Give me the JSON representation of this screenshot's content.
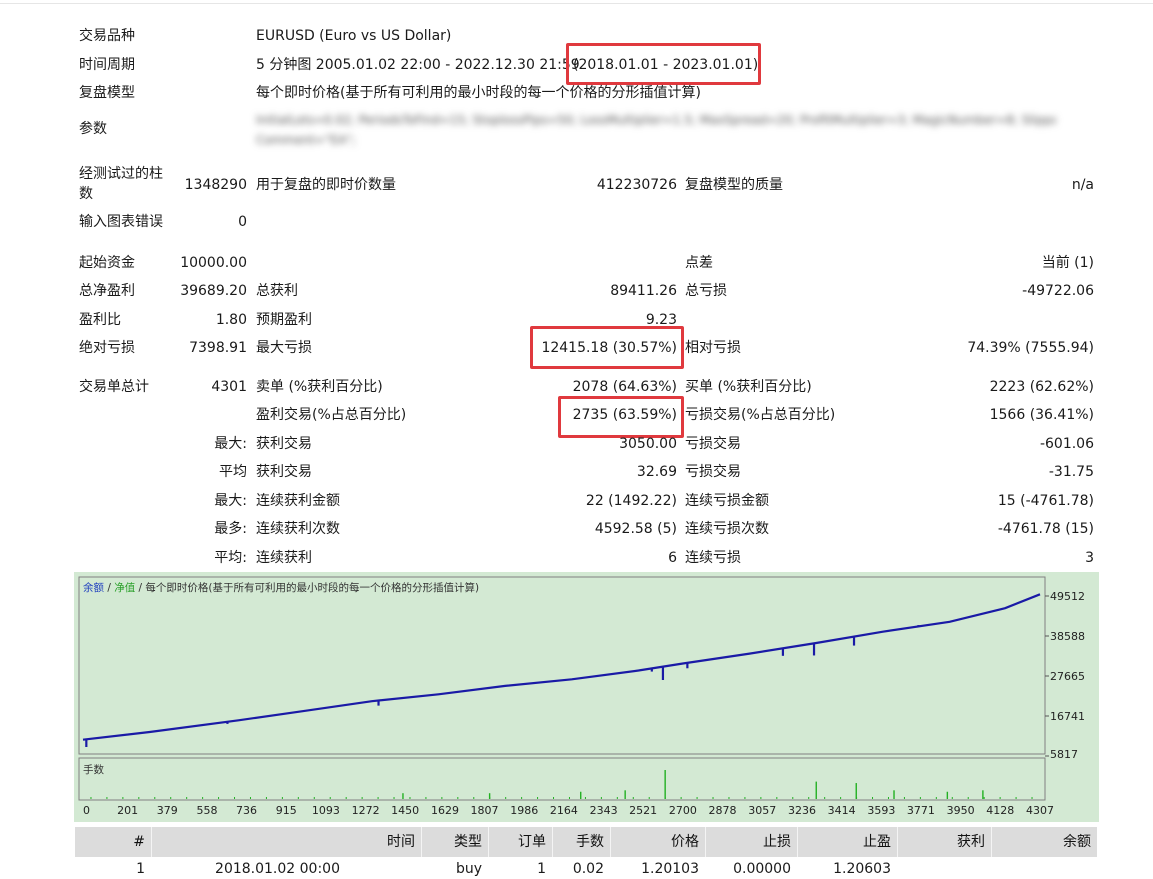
{
  "info": {
    "symbol_label": "交易品种",
    "symbol_value": "EURUSD (Euro vs US Dollar)",
    "period_label": "时间周期",
    "period_value": "5 分钟图 2005.01.02 22:00 - 2022.12.30 21:59",
    "period_range": "(2018.01.01 - 2023.01.01)",
    "model_label": "复盘模型",
    "model_value": "每个即时价格(基于所有可利用的最小时段的每一个价格的分形插值计算)",
    "params_label": "参数",
    "params_line1": "InitialLots=0.02; PeriodsToFind=15; StoplossPips=50; LossMultiplier=1.5; MaxSpread=20; ProfitMultiplier=3; MagicNumber=8; Slippage=7;",
    "params_line2": "Comment=\"EA\";",
    "bars_label_1": "经测试过的柱",
    "bars_label_2": "数",
    "bars_value": "1348290",
    "ticks_label": "用于复盘的即时价数量",
    "ticks_value": "412230726",
    "quality_label": "复盘模型的质量",
    "quality_value": "n/a",
    "errors_label": "输入图表错误",
    "errors_value": "0"
  },
  "stats": {
    "initial_deposit_label": "起始资金",
    "initial_deposit": "10000.00",
    "spread_label": "点差",
    "spread": "当前 (1)",
    "net_profit_label": "总净盈利",
    "net_profit": "39689.20",
    "gross_profit_label": "总获利",
    "gross_profit": "89411.26",
    "gross_loss_label": "总亏损",
    "gross_loss": "-49722.06",
    "profit_factor_label": "盈利比",
    "profit_factor": "1.80",
    "expected_payoff_label": "预期盈利",
    "expected_payoff": "9.23",
    "abs_drawdown_label": "绝对亏损",
    "abs_drawdown": "7398.91",
    "max_drawdown_label": "最大亏损",
    "max_drawdown": "12415.18 (30.57%)",
    "rel_drawdown_label": "相对亏损",
    "rel_drawdown": "74.39% (7555.94)",
    "total_trades_label": "交易单总计",
    "total_trades": "4301",
    "short_label": "卖单 (%获利百分比)",
    "short_value": "2078 (64.63%)",
    "long_label": "买单 (%获利百分比)",
    "long_value": "2223 (62.62%)",
    "profit_trades_label": "盈利交易(%占总百分比)",
    "profit_trades": "2735 (63.59%)",
    "loss_trades_label": "亏损交易(%占总百分比)",
    "loss_trades": "1566 (36.41%)",
    "largest_label": "最大:",
    "largest_profit_label": "获利交易",
    "largest_profit": "3050.00",
    "largest_loss_label": "亏损交易",
    "largest_loss": "-601.06",
    "average_label": "平均",
    "average_profit_label": "获利交易",
    "average_profit": "32.69",
    "average_loss_label": "亏损交易",
    "average_loss": "-31.75",
    "max_consec_label": "最大:",
    "max_consec_wins_label": "连续获利金额",
    "max_consec_wins": "22 (1492.22)",
    "max_consec_losses_label": "连续亏损金额",
    "max_consec_losses": "15 (-4761.78)",
    "maximal_consec_label": "最多:",
    "maximal_consec_profit_label": "连续获利次数",
    "maximal_consec_profit": "4592.58 (5)",
    "maximal_consec_loss_label": "连续亏损次数",
    "maximal_consec_loss": "-4761.78 (15)",
    "avg_consec_label": "平均:",
    "avg_consec_wins_label": "连续获利",
    "avg_consec_wins": "6",
    "avg_consec_losses_label": "连续亏损",
    "avg_consec_losses": "3"
  },
  "chart_data": {
    "type": "line",
    "legend_balance": "余额",
    "legend_sep1": " / ",
    "legend_equity": "净值",
    "legend_rest": " / 每个即时价格(基于所有可利用的最小时段的每一个价格的分形插值计算)",
    "lots_label": "手数",
    "y_ticks": [
      "49512",
      "38588",
      "27665",
      "16741",
      "5817"
    ],
    "y_tick_values": [
      49512,
      38588,
      27665,
      16741,
      5817
    ],
    "x_ticks": [
      "0",
      "201",
      "379",
      "558",
      "736",
      "915",
      "1093",
      "1272",
      "1450",
      "1629",
      "1807",
      "1986",
      "2164",
      "2343",
      "2521",
      "2700",
      "2878",
      "3057",
      "3236",
      "3414",
      "3593",
      "3771",
      "3950",
      "4128",
      "4307"
    ],
    "x_tick_values": [
      0,
      201,
      379,
      558,
      736,
      915,
      1093,
      1272,
      1450,
      1629,
      1807,
      1986,
      2164,
      2343,
      2521,
      2700,
      2878,
      3057,
      3236,
      3414,
      3593,
      3771,
      3950,
      4128,
      4307
    ],
    "xlim": [
      0,
      4307
    ],
    "ylim": [
      5817,
      49512
    ],
    "series": [
      {
        "name": "余额",
        "x": [
          0,
          300,
          700,
          1000,
          1300,
          1600,
          1900,
          2200,
          2500,
          2700,
          3000,
          3300,
          3600,
          3900,
          4150,
          4307
        ],
        "y": [
          10000,
          12100,
          15300,
          17900,
          20500,
          22400,
          24700,
          26500,
          28900,
          30800,
          33500,
          36400,
          39500,
          42200,
          45900,
          49700
        ]
      }
    ],
    "dips": [
      {
        "x": 15,
        "y": 8000
      },
      {
        "x": 650,
        "y": 14300
      },
      {
        "x": 1330,
        "y": 19300
      },
      {
        "x": 2560,
        "y": 28600
      },
      {
        "x": 2610,
        "y": 26300
      },
      {
        "x": 2720,
        "y": 29500
      },
      {
        "x": 3150,
        "y": 32900
      },
      {
        "x": 3290,
        "y": 33000
      },
      {
        "x": 3470,
        "y": 35700
      },
      {
        "x": 3760,
        "y": 41300
      },
      {
        "x": 3980,
        "y": 43500
      }
    ],
    "lots_spikes": [
      {
        "x": 2620,
        "h": 1.0
      },
      {
        "x": 3300,
        "h": 0.6
      },
      {
        "x": 3480,
        "h": 0.55
      },
      {
        "x": 2440,
        "h": 0.3
      },
      {
        "x": 2240,
        "h": 0.25
      },
      {
        "x": 3650,
        "h": 0.3
      },
      {
        "x": 3890,
        "h": 0.25
      },
      {
        "x": 4050,
        "h": 0.3
      },
      {
        "x": 1830,
        "h": 0.2
      },
      {
        "x": 1440,
        "h": 0.2
      }
    ]
  },
  "table": {
    "headers": [
      "#",
      "时间",
      "类型",
      "订单",
      "手数",
      "价格",
      "止损",
      "止盈",
      "获利",
      "余额"
    ],
    "first_row": [
      "1",
      "2018.01.02 00:00",
      "buy",
      "1",
      "0.02",
      "1.20103",
      "0.00000",
      "1.20603",
      "",
      ""
    ]
  }
}
